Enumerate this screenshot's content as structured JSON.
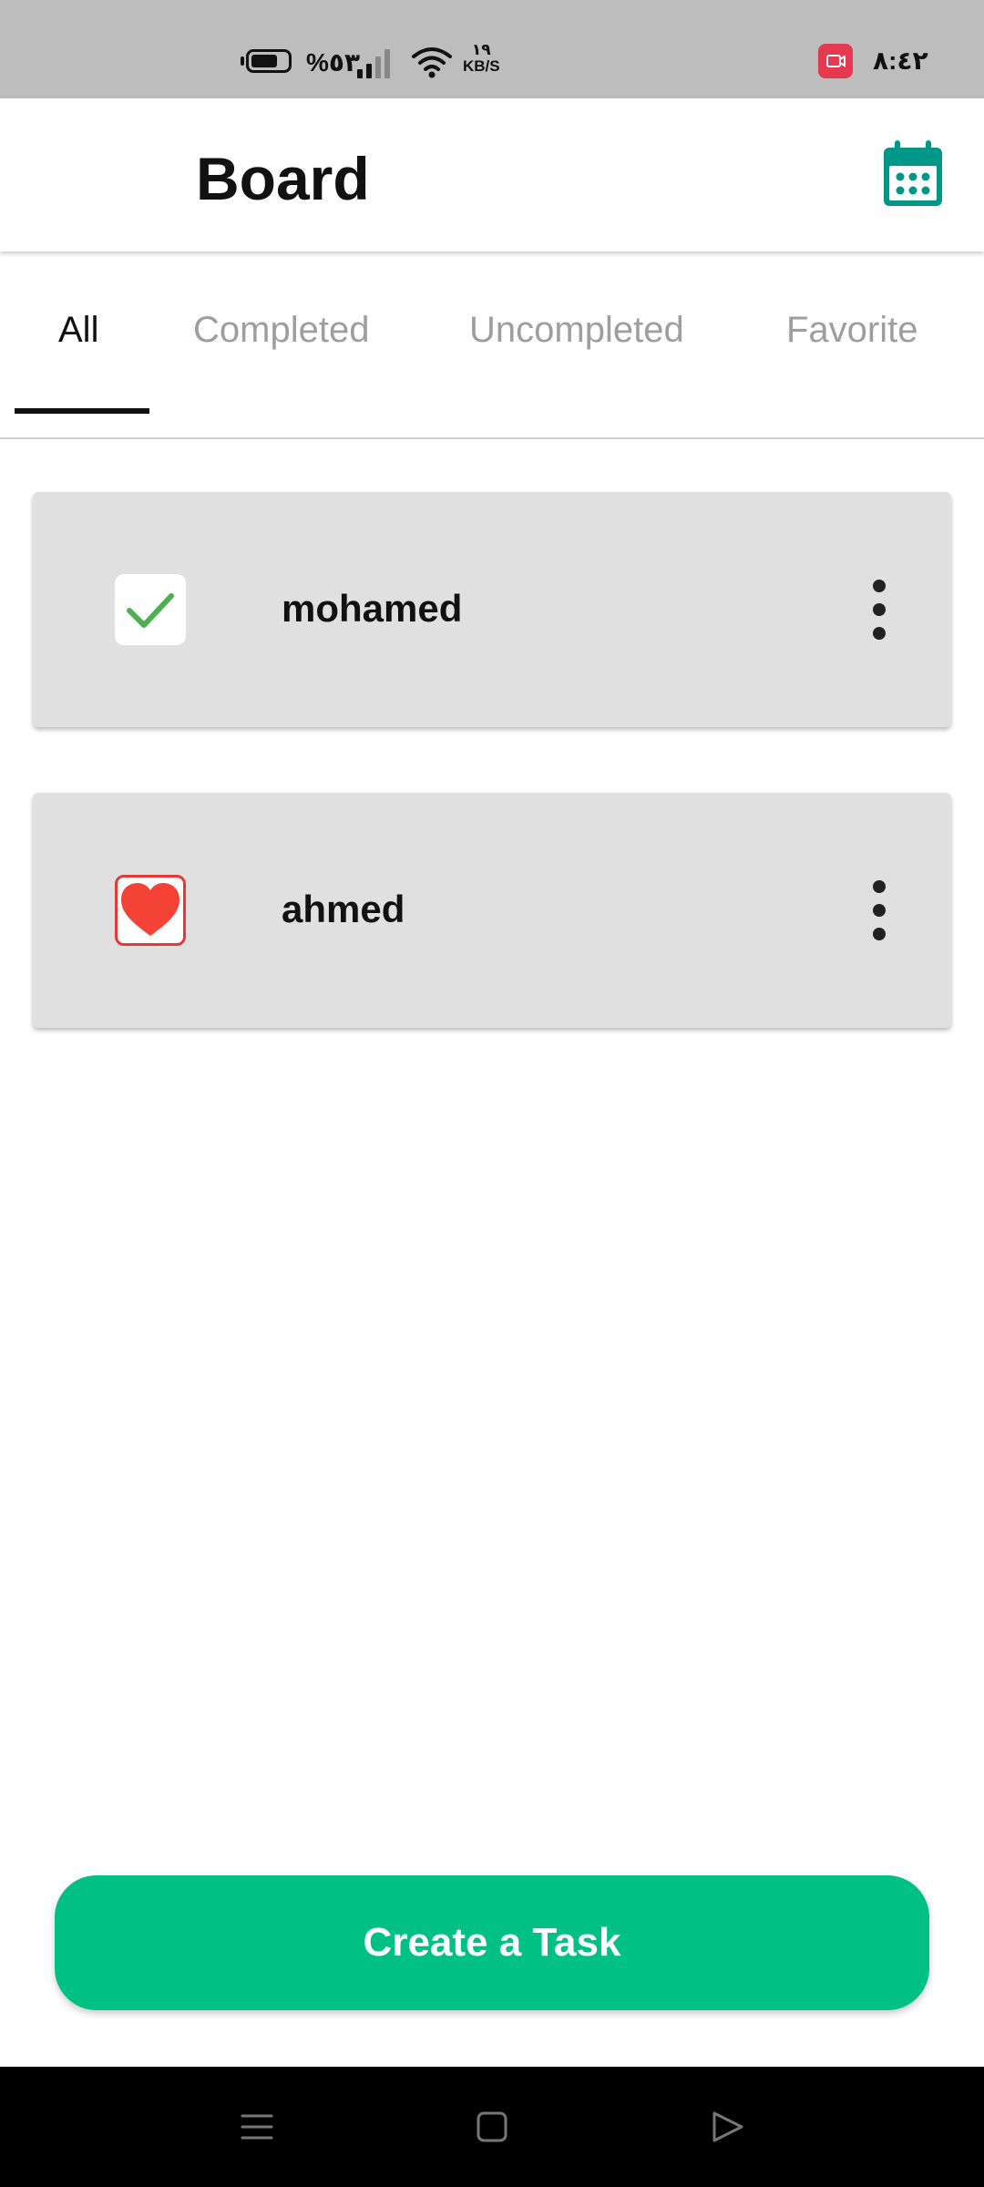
{
  "status_bar": {
    "battery_text": "%٥٣",
    "network_speed_value": "١٩",
    "network_speed_unit": "KB/S",
    "clock": "٨:٤٢"
  },
  "header": {
    "title": "Board"
  },
  "tabs": [
    {
      "label": "All",
      "active": true
    },
    {
      "label": "Completed",
      "active": false
    },
    {
      "label": "Uncompleted",
      "active": false
    },
    {
      "label": "Favorite",
      "active": false
    }
  ],
  "tasks": [
    {
      "name": "mohamed",
      "status": "completed",
      "icon": "check-icon"
    },
    {
      "name": "ahmed",
      "status": "favorite",
      "icon": "heart-icon"
    }
  ],
  "create_button": {
    "label": "Create a Task"
  },
  "colors": {
    "accent": "#00c084",
    "calendar": "#009688",
    "check": "#4caf50",
    "heart": "#f44336"
  }
}
